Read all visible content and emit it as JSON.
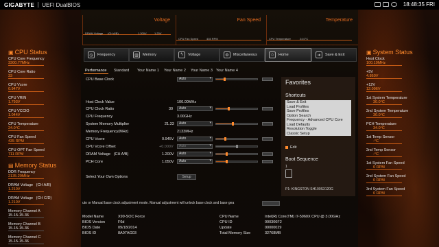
{
  "header": {
    "brand": "GIGABYTE",
    "product": "UEFI DualBIOS",
    "clock": "18:48:35 FRI",
    "icons": [
      "keyboard-icon",
      "screen-icon",
      "help-icon"
    ]
  },
  "graphs": {
    "voltage": {
      "title": "Voltage",
      "line_label": "DRAM Voltage",
      "channel": "(CH A/B)",
      "value": "1.200V",
      "end": "1.20V"
    },
    "fan": {
      "title": "Fan Speed",
      "line_label": "CPU Fan Speed",
      "value": "435 RPM"
    },
    "temperature": {
      "title": "Temperature",
      "line_label": "CPU Temperature",
      "value": "24.0°C"
    }
  },
  "cpu_status": {
    "title": "CPU Status",
    "items": [
      {
        "label": "CPU Core Frequency",
        "value": "3300.77MHz"
      },
      {
        "label": "CPU Core Ratio",
        "value": "33"
      },
      {
        "label": "CPU Vcore",
        "value": "0.947V"
      },
      {
        "label": "CPU VRIN",
        "value": "1.793V"
      },
      {
        "label": "CPU VCCIO",
        "value": "1.044V"
      },
      {
        "label": "CPU Temperature",
        "value": "24.0°C"
      },
      {
        "label": "CPU Fan Speed",
        "value": "435 RPM"
      },
      {
        "label": "CPU OPT Fan Speed",
        "value": "711 RPM"
      }
    ]
  },
  "memory_status": {
    "title": "Memory Status",
    "items": [
      {
        "label": "DDR Frequency",
        "value": "2135.29MHz"
      },
      {
        "label": "DRAM Voltage",
        "channel": "(CH A/B)",
        "value": "1.210V"
      },
      {
        "label": "DRAM Voltage",
        "channel": "(CH C/D)",
        "value": "1.210V"
      },
      {
        "label": "Memory Channel A",
        "value": "15-15-15-36"
      },
      {
        "label": "Memory Channel B",
        "value": "15-15-15-36"
      },
      {
        "label": "Memory Channel C",
        "value": "15-15-15-36"
      }
    ]
  },
  "system_status": {
    "title": "System Status",
    "items": [
      {
        "label": "Host Clock",
        "value": "100.10MHz"
      },
      {
        "label": "+5V",
        "value": "4.860V"
      },
      {
        "label": "+12V",
        "value": "12.096V"
      },
      {
        "label": "1st System Temperature",
        "value": "30.0°C"
      },
      {
        "label": "2nd System Temperature",
        "value": "30.0°C"
      },
      {
        "label": "PCH Temperature",
        "value": "34.0°C"
      },
      {
        "label": "1st Temp Sensor",
        "value": "-°C"
      },
      {
        "label": "2nd Temp Sensor",
        "value": "-°C"
      },
      {
        "label": "1st System Fan Speed",
        "value": "0 RPM"
      },
      {
        "label": "2nd System Fan Speed",
        "value": "0 RPM"
      },
      {
        "label": "3rd System Fan Speed",
        "value": "0 RPM"
      }
    ]
  },
  "nav_tabs": [
    {
      "label": "Frequency",
      "icon": "frequency-icon"
    },
    {
      "label": "Memory",
      "icon": "memory-icon"
    },
    {
      "label": "Voltage",
      "icon": "voltage-icon"
    },
    {
      "label": "Miscellaneous",
      "icon": "gear-icon"
    },
    {
      "label": "Home",
      "icon": "home-icon"
    },
    {
      "label": "Save & Exit",
      "icon": "save-exit-icon"
    }
  ],
  "sub_tabs": [
    "Performance",
    "Standard",
    "Your Name 1",
    "Your Name 2",
    "Your Name 3",
    "Your Name 4"
  ],
  "settings": {
    "cpu_base_clock": {
      "label": "CPU Base Clock",
      "dropdown": "Auto"
    },
    "host_clock": {
      "label": "Host Clock Value",
      "value": "100.00MHz"
    },
    "cpu_clock_ratio": {
      "label": "CPU Clock Ratio",
      "value": "30",
      "dropdown": "Auto"
    },
    "cpu_frequency": {
      "label": "CPU Frequency",
      "value": "3.00GHz"
    },
    "mem_multiplier": {
      "label": "System Memory Multiplier",
      "value": "21.33",
      "dropdown": "Auto"
    },
    "mem_frequency": {
      "label": "Memory Frequency(MHz)",
      "value": "2133MHz"
    },
    "cpu_vcore": {
      "label": "CPU Vcore",
      "value": "0.945V",
      "dropdown": "Auto"
    },
    "cpu_vcore_offset": {
      "label": "CPU Vcore Offset",
      "value": "+0.000V",
      "dropdown": "Auto"
    },
    "dram_voltage": {
      "label": "DRAM Voltage",
      "channel": "(CH A/B)",
      "value": "1.200V",
      "dropdown": "Auto"
    },
    "pch_core": {
      "label": "PCH Core",
      "value": "1.050V",
      "dropdown": "Auto"
    },
    "your_own": {
      "label": "Select Your Own Options",
      "button": "Setup"
    }
  },
  "favorites": {
    "title": "Favorites",
    "shortcuts_title": "Shortcuts",
    "shortcuts": [
      "Save & Exit",
      "Load Profiles",
      "Save Profiles",
      "Option Search",
      "Frequency - Advanced CPU Core",
      "Load Defaults",
      "Resolution Toggle",
      "Classic Setup"
    ],
    "edit_label": "Edit",
    "boot_title": "Boot Sequence",
    "boot_number": "1",
    "boot_device": "P1: KINGSTON SH100S3120G"
  },
  "help_text": "uto or Manual base clock adjustment mode. Manual adjustment will unlock base clock and base gea",
  "bottom_info": {
    "left": [
      {
        "label": "Model Name",
        "value": "X99-SOC Force"
      },
      {
        "label": "BIOS Version",
        "value": "F6d"
      },
      {
        "label": "BIOS Date",
        "value": "09/18/2014"
      },
      {
        "label": "BIOS ID",
        "value": "8A07AG03"
      }
    ],
    "right": [
      {
        "label": "CPU Name",
        "value": "Intel(R) Core(TM) i7-5960X CPU @ 3.00GHz"
      },
      {
        "label": "CPU ID",
        "value": "000306F2"
      },
      {
        "label": "Update",
        "value": "00000029"
      },
      {
        "label": "Total Memory Size",
        "value": "32768MB"
      }
    ]
  }
}
